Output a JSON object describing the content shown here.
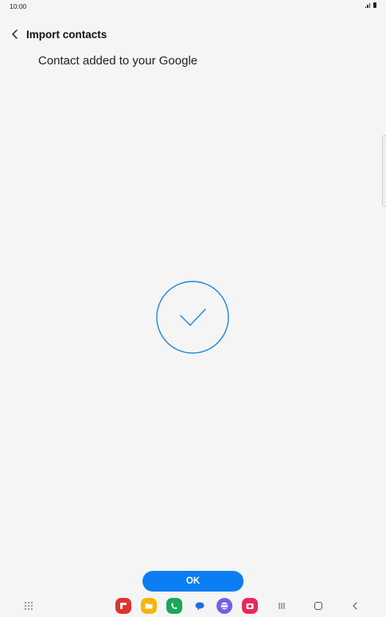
{
  "status": {
    "time": "10:00"
  },
  "header": {
    "title": "Import contacts",
    "back_icon": "chevron-left-icon"
  },
  "message": "Contact added to your Google",
  "success_icon": "checkmark-circle-icon",
  "ok_label": "OK",
  "colors": {
    "accent": "#0a7ef2",
    "check": "#1b86d9",
    "background": "#f5f5f5"
  },
  "navigation": {
    "dock_apps": [
      "flipboard-icon",
      "files-icon",
      "phone-icon",
      "messages-icon",
      "internet-icon",
      "camera-icon"
    ],
    "keys": [
      "recents-icon",
      "home-icon",
      "back-icon"
    ]
  }
}
